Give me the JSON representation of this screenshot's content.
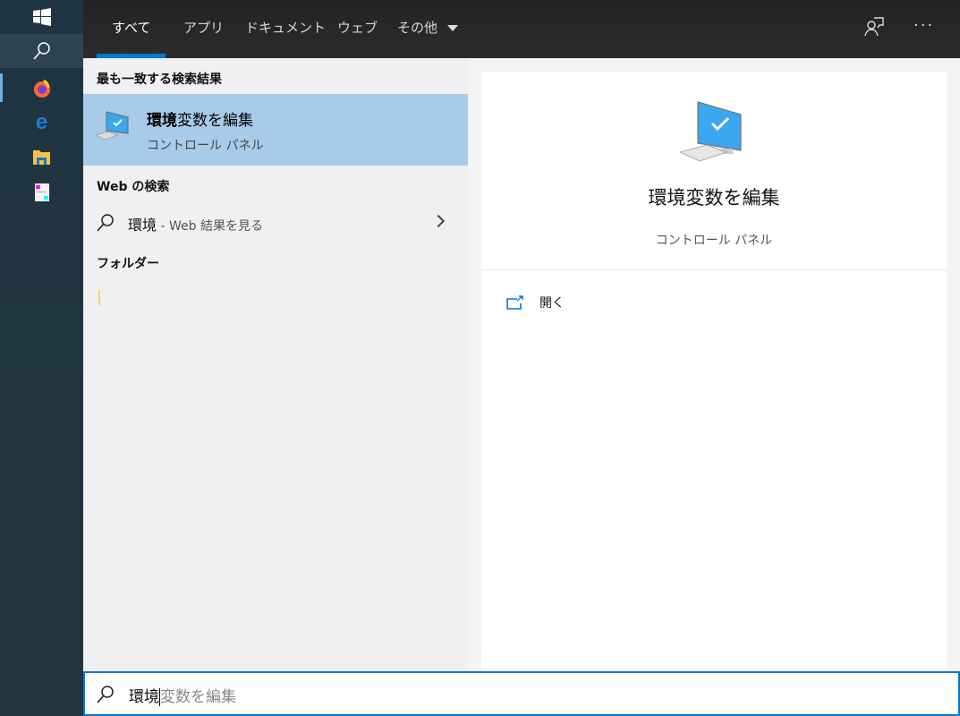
{
  "tabs": [
    {
      "label": "すべて"
    },
    {
      "label": "アプリ"
    },
    {
      "label": "ドキュメント"
    },
    {
      "label": "ウェブ"
    },
    {
      "label": "その他"
    }
  ],
  "left": {
    "best_match_header": "最も一致する検索結果",
    "best_match": {
      "title_bold": "環境",
      "title_rest": "変数を編集",
      "subtitle": "コントロール パネル"
    },
    "web_header": "Web の検索",
    "web_item": {
      "query": "環境",
      "suffix": " - Web 結果を見る"
    },
    "folders_header": "フォルダー"
  },
  "right": {
    "title": "環境変数を編集",
    "subtitle": "コントロール パネル",
    "open_label": "開く"
  },
  "search": {
    "typed": "環境",
    "suggestion": "変数を編集"
  },
  "colors": {
    "accent": "#0078d7",
    "selected": "#a8cbe9"
  }
}
